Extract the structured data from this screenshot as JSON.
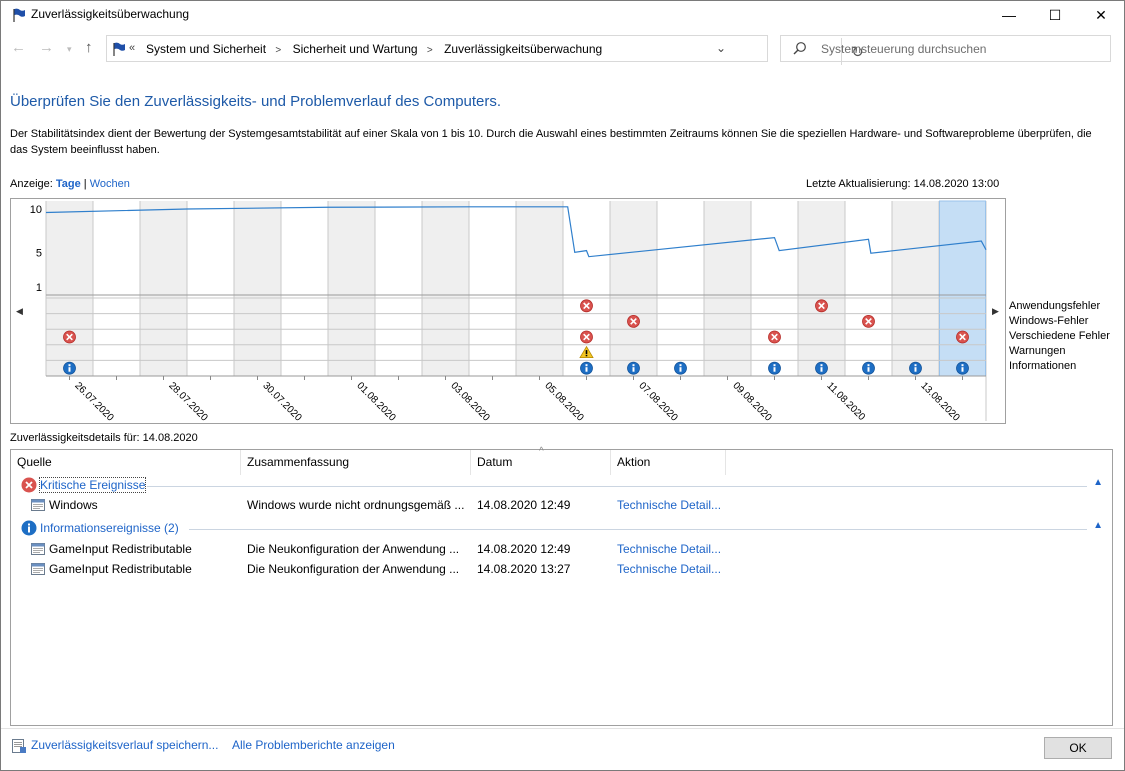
{
  "window": {
    "title": "Zuverlässigkeitsüberwachung",
    "minimize": "—",
    "maximize": "☐",
    "close": "✕"
  },
  "address": {
    "crumbs_prefix": "«",
    "crumbs": [
      "System und Sicherheit",
      "Sicherheit und Wartung",
      "Zuverlässigkeitsüberwachung"
    ],
    "crumb_sep": ">"
  },
  "search": {
    "placeholder": "Systemsteuerung durchsuchen"
  },
  "page": {
    "title": "Überprüfen Sie den Zuverlässigkeits- und Problemverlauf des Computers.",
    "description": "Der Stabilitätsindex dient der Bewertung der Systemgesamtstabilität auf einer Skala von 1 bis 10. Durch die Auswahl eines bestimmten Zeitraums können Sie die speziellen Hardware- und Softwareprobleme überprüfen, die das System beeinflusst haben.",
    "view_label": "Anzeige:",
    "view_days": "Tage",
    "view_sep": "|",
    "view_weeks": "Wochen",
    "last_update": "Letzte Aktualisierung: 14.08.2020 13:00"
  },
  "chart_data": {
    "type": "line",
    "y_ticks": [
      "10",
      "5",
      "1"
    ],
    "ylim": [
      1,
      10
    ],
    "x_labels": [
      "26.07.2020",
      "28.07.2020",
      "30.07.2020",
      "01.08.2020",
      "03.08.2020",
      "05.08.2020",
      "07.08.2020",
      "09.08.2020",
      "11.08.2020",
      "13.08.2020"
    ],
    "stability_series": [
      {
        "x": 0,
        "y": 9.6
      },
      {
        "x": 3,
        "y": 10.0
      },
      {
        "x": 6,
        "y": 10.2
      },
      {
        "x": 9,
        "y": 10.25
      },
      {
        "x": 11.1,
        "y": 10.25
      },
      {
        "x": 11.25,
        "y": 5.0
      },
      {
        "x": 11.5,
        "y": 5.2
      },
      {
        "x": 11.55,
        "y": 4.5
      },
      {
        "x": 15.5,
        "y": 6.7
      },
      {
        "x": 15.6,
        "y": 5.2
      },
      {
        "x": 17.5,
        "y": 6.5
      },
      {
        "x": 17.55,
        "y": 4.9
      },
      {
        "x": 19.9,
        "y": 6.3
      },
      {
        "x": 20,
        "y": 5.3
      }
    ],
    "categories": [
      "Anwendungsfehler",
      "Windows-Fehler",
      "Verschiedene Fehler",
      "Warnungen",
      "Informationen"
    ],
    "events": [
      {
        "day": 0,
        "row": 2,
        "kind": "error"
      },
      {
        "day": 0,
        "row": 4,
        "kind": "info"
      },
      {
        "day": 11,
        "row": 0,
        "kind": "error"
      },
      {
        "day": 11,
        "row": 2,
        "kind": "error"
      },
      {
        "day": 11,
        "row": 3,
        "kind": "warning"
      },
      {
        "day": 11,
        "row": 4,
        "kind": "info"
      },
      {
        "day": 12,
        "row": 1,
        "kind": "error"
      },
      {
        "day": 12,
        "row": 4,
        "kind": "info"
      },
      {
        "day": 13,
        "row": 4,
        "kind": "info"
      },
      {
        "day": 15,
        "row": 2,
        "kind": "error"
      },
      {
        "day": 15,
        "row": 4,
        "kind": "info"
      },
      {
        "day": 16,
        "row": 0,
        "kind": "error"
      },
      {
        "day": 16,
        "row": 4,
        "kind": "info"
      },
      {
        "day": 17,
        "row": 1,
        "kind": "error"
      },
      {
        "day": 17,
        "row": 4,
        "kind": "info"
      },
      {
        "day": 18,
        "row": 4,
        "kind": "info"
      },
      {
        "day": 19,
        "row": 2,
        "kind": "error"
      },
      {
        "day": 19,
        "row": 4,
        "kind": "info"
      }
    ],
    "selected_day": 19,
    "day_count": 20,
    "gray_days": [
      0,
      2,
      4,
      6,
      8,
      10,
      12,
      14,
      16,
      18
    ]
  },
  "details": {
    "label": "Zuverlässigkeitsdetails für: 14.08.2020",
    "columns": [
      "Quelle",
      "Zusammenfassung",
      "Datum",
      "Aktion"
    ],
    "groups": [
      {
        "title": "Kritische Ereignisse",
        "rows": [
          {
            "source": "Windows",
            "summary": "Windows wurde nicht ordnungsgemäß ...",
            "date": "14.08.2020 12:49",
            "action": "Technische Detail..."
          }
        ]
      },
      {
        "title": "Informationsereignisse (2)",
        "rows": [
          {
            "source": "GameInput Redistributable",
            "summary": "Die Neukonfiguration der Anwendung ...",
            "date": "14.08.2020 12:49",
            "action": "Technische Detail..."
          },
          {
            "source": "GameInput Redistributable",
            "summary": "Die Neukonfiguration der Anwendung ...",
            "date": "14.08.2020 13:27",
            "action": "Technische Detail..."
          }
        ]
      }
    ]
  },
  "footer": {
    "save_link": "Zuverlässigkeitsverlauf speichern...",
    "all_reports_link": "Alle Problemberichte anzeigen",
    "ok": "OK"
  }
}
